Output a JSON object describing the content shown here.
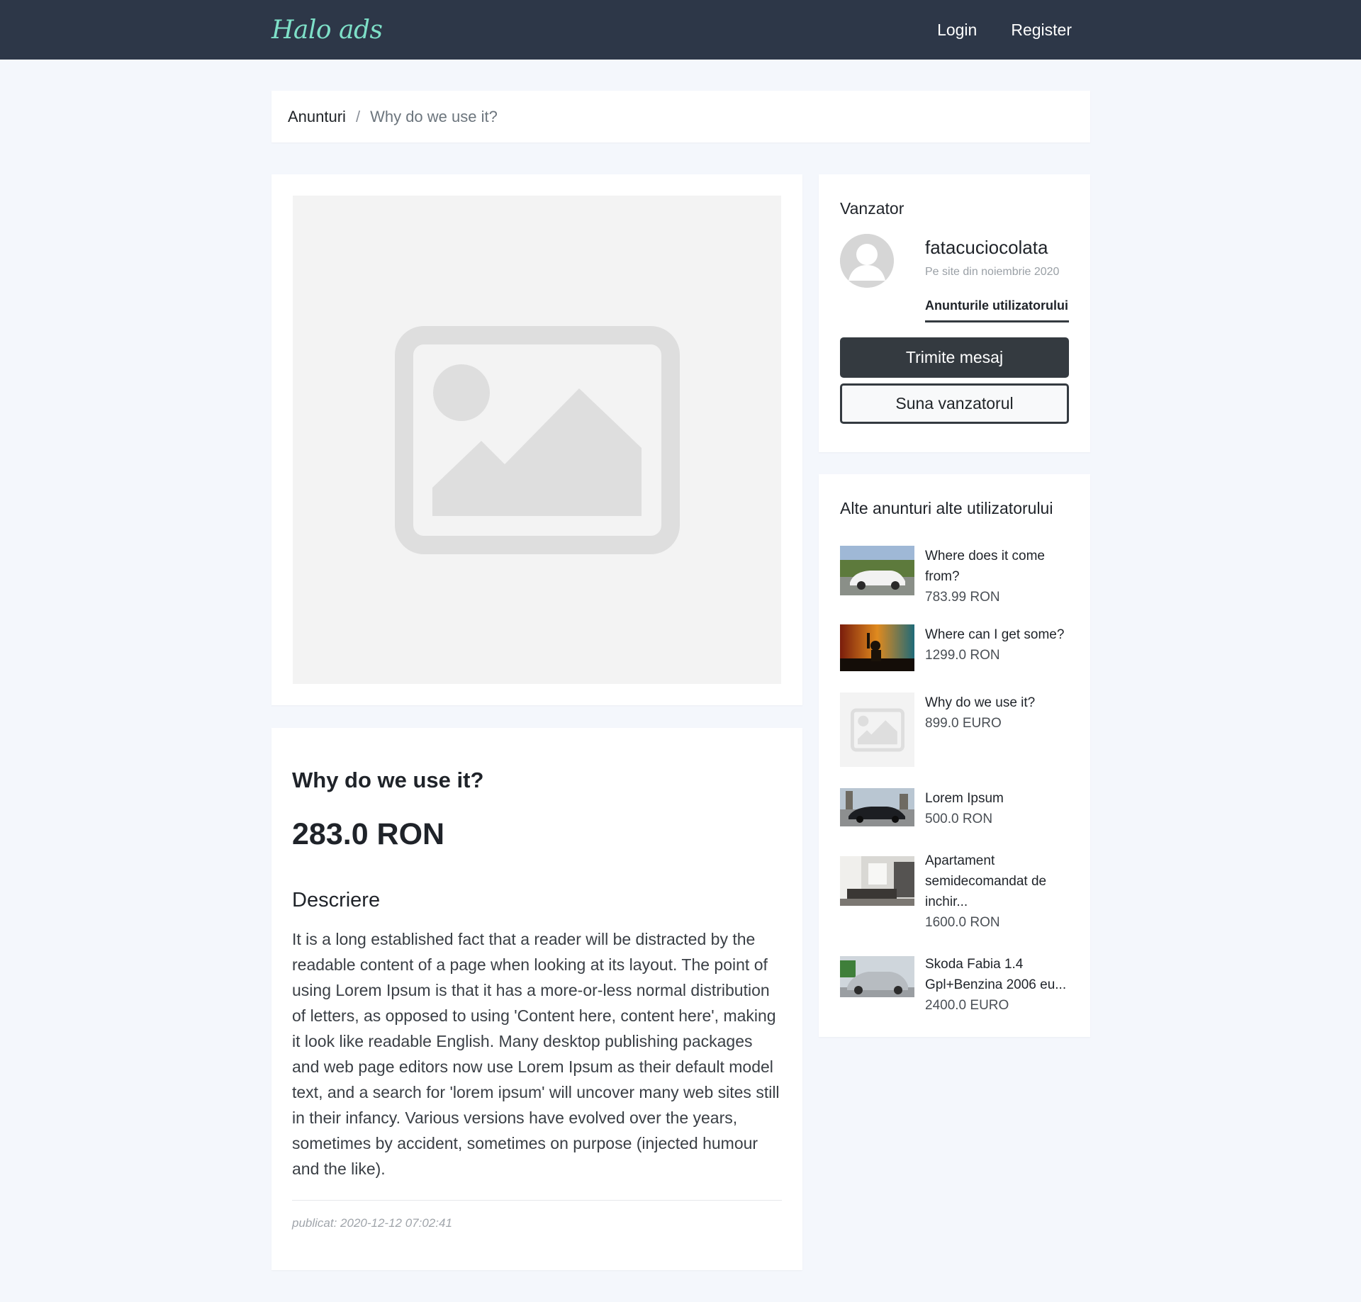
{
  "nav": {
    "brand": "Halo ads",
    "login": "Login",
    "register": "Register"
  },
  "breadcrumb": {
    "root": "Anunturi",
    "separator": "/",
    "current": "Why do we use it?"
  },
  "ad": {
    "title": "Why do we use it?",
    "price": "283.0 RON",
    "description_heading": "Descriere",
    "description": "It is a long established fact that a reader will be distracted by the readable content of a page when looking at its layout. The point of using Lorem Ipsum is that it has a more-or-less normal distribution of letters, as opposed to using 'Content here, content here', making it look like readable English. Many desktop publishing packages and web page editors now use Lorem Ipsum as their default model text, and a search for 'lorem ipsum' will uncover many web sites still in their infancy. Various versions have evolved over the years, sometimes by accident, sometimes on purpose (injected humour and the like).",
    "published": "publicat: 2020-12-12 07:02:41",
    "image_icon": "image-placeholder-icon"
  },
  "seller": {
    "heading": "Vanzator",
    "name": "fatacuciocolata",
    "since": "Pe site din noiembrie 2020",
    "ads_link": "Anunturile utilizatorului",
    "message_button": "Trimite mesaj",
    "call_button": "Suna vanzatorul",
    "avatar_icon": "user-avatar-icon"
  },
  "other_ads": {
    "heading": "Alte anunturi alte utilizatorului",
    "items": [
      {
        "title": "Where does it come from?",
        "price": "783.99 RON",
        "thumb": "white-car-photo"
      },
      {
        "title": "Where can I get some?",
        "price": "1299.0 RON",
        "thumb": "concert-photo"
      },
      {
        "title": "Why do we use it?",
        "price": "899.0 EURO",
        "thumb": "image-placeholder-icon"
      },
      {
        "title": "Lorem Ipsum",
        "price": "500.0 RON",
        "thumb": "dark-car-photo"
      },
      {
        "title": "Apartament semidecomandat de inchir...",
        "price": "1600.0 RON",
        "thumb": "apartment-photo"
      },
      {
        "title": "Skoda Fabia 1.4 Gpl+Benzina 2006 eu...",
        "price": "2400.0 EURO",
        "thumb": "silver-car-photo"
      }
    ]
  },
  "colors": {
    "navbar": "#2d3748",
    "brand": "#7ee0c8",
    "page_background": "#f4f7fc",
    "dark_button": "#343a40"
  }
}
